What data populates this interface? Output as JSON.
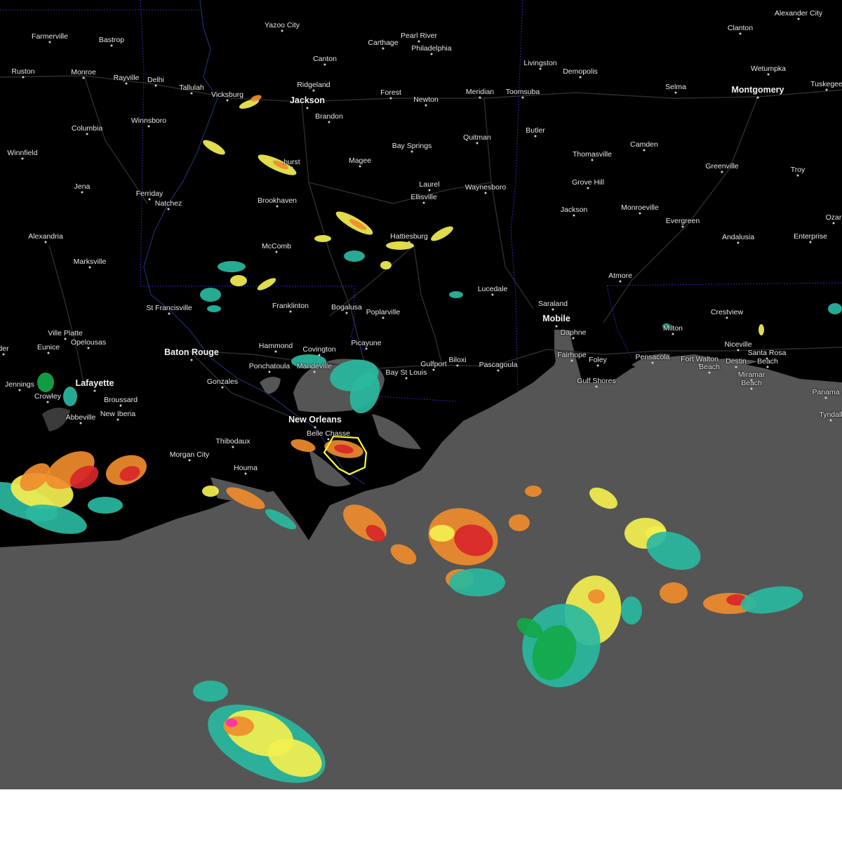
{
  "colors": {
    "land": "#000000",
    "water": "#555555",
    "roads": "#2e2e2e",
    "state_border": "#2a2ab8",
    "warning_polygon": "#ffff33",
    "radar_light": "#2ab8a0",
    "radar_green": "#14a84a",
    "radar_yellow": "#f3ef50",
    "radar_orange": "#ef8c2c",
    "radar_red": "#d8262a",
    "radar_magenta": "#ff2ab0"
  },
  "map": {
    "major_cities": [
      "Jackson",
      "Baton Rouge",
      "New Orleans",
      "Mobile",
      "Montgomery",
      "Lafayette"
    ],
    "cities": [
      "Farmerville",
      "Bastrop",
      "Yazoo City",
      "Carthage",
      "Pearl River",
      "Philadelphia",
      "Alexander City",
      "Clanton",
      "Canton",
      "Livingston",
      "Demopolis",
      "Ruston",
      "Monroe",
      "Rayville",
      "Delhi",
      "Tallulah",
      "Vicksburg",
      "Ridgeland",
      "Forest",
      "Meridian",
      "Toomsuba",
      "Newton",
      "Wetumpka",
      "Selma",
      "Tuskegee",
      "Brandon",
      "Winnsboro",
      "Columbia",
      "Butler",
      "Quitman",
      "Bay Springs",
      "Thomasville",
      "Camden",
      "Winnfield",
      "hurst",
      "Magee",
      "Greenville",
      "Troy",
      "Jena",
      "Ferriday",
      "Natchez",
      "Laurel",
      "Waynesboro",
      "Grove Hill",
      "Brookhaven",
      "Ellisville",
      "Jackson",
      "Monroeville",
      "Evergreen",
      "Ozar",
      "Alexandria",
      "Hattiesburg",
      "McComb",
      "Andalusia",
      "Enterprise",
      "Marksville",
      "Atmore",
      "Lucedale",
      "St Francisville",
      "Franklinton",
      "Bogalusa",
      "Poplarville",
      "Saraland",
      "Crestview",
      "Ville Platte",
      "Opelousas",
      "Milton",
      "Eunice",
      "Picayune",
      "Hammond",
      "Covington",
      "Niceville",
      "Daphne",
      "Fairhope",
      "Foley",
      "Pensacola",
      "Fort Walton",
      "Beach",
      "Destin",
      "Santa Rosa",
      "Beach",
      "der",
      "Ponchatoula",
      "Mandeville",
      "Gulfport",
      "Biloxi",
      "Pascagoula",
      "Jennings",
      "Bay St Louis",
      "Gulf Shores",
      "Gonzales",
      "Miramar",
      "Beach",
      "Crowley",
      "Broussard",
      "Panama",
      "Abbeville",
      "New Iberia",
      "Tyndall",
      "Thibodaux",
      "Belle Chasse",
      "Morgan City",
      "Houma"
    ]
  }
}
